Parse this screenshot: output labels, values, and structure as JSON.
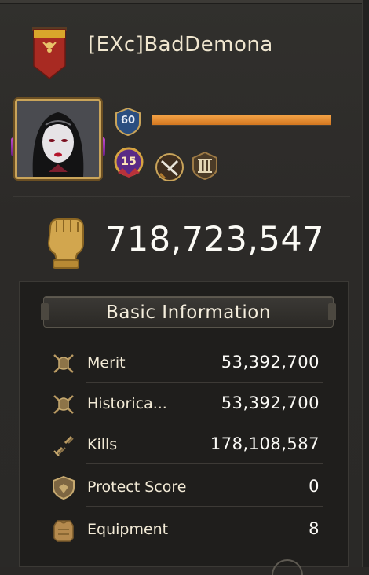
{
  "profile": {
    "name": "[EXc]BadDemona",
    "level": "60",
    "level_progress": 1.0,
    "vip": "15",
    "power": "718,723,547"
  },
  "basic_info": {
    "title": "Basic Information",
    "rows": [
      {
        "label": "Merit",
        "value": "53,392,700",
        "icon": "crossed-swords-helmet-icon"
      },
      {
        "label": "Historica...",
        "value": "53,392,700",
        "icon": "crossed-swords-helmet-icon"
      },
      {
        "label": "Kills",
        "value": "178,108,587",
        "icon": "broken-swords-icon"
      },
      {
        "label": "Protect Score",
        "value": "0",
        "icon": "shield-crest-icon"
      },
      {
        "label": "Equipment",
        "value": "8",
        "icon": "armor-icon"
      }
    ]
  },
  "colors": {
    "accent_gold": "#c9a45a",
    "xp_orange": "#e58a2f",
    "banner_red": "#b3261e"
  }
}
